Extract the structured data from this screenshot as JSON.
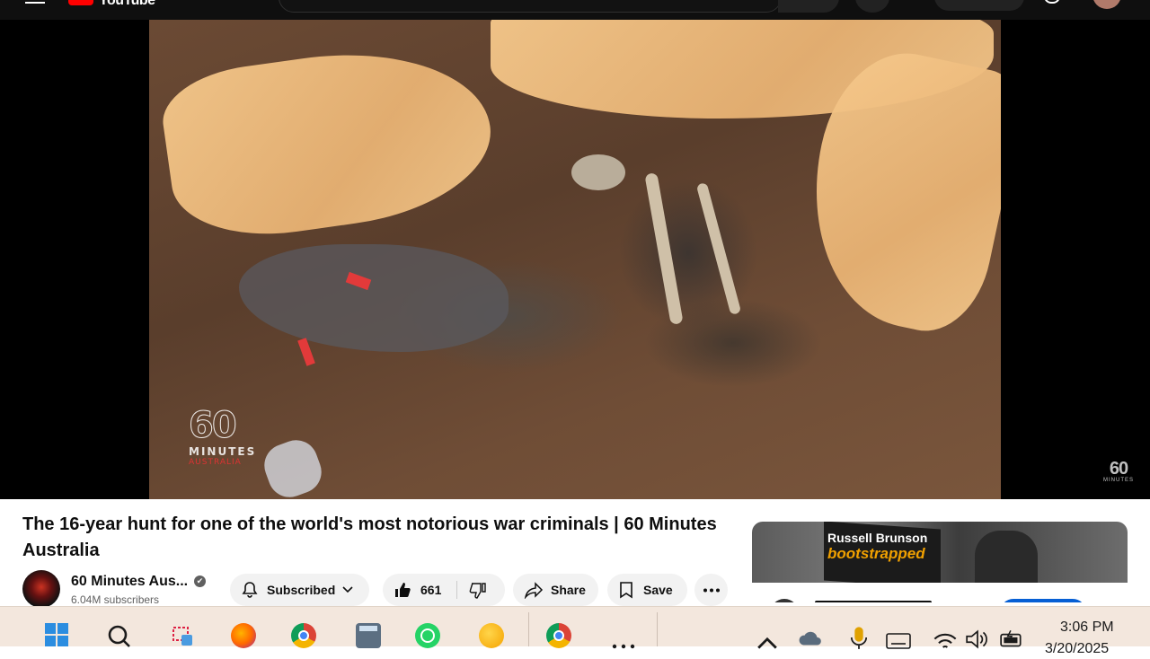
{
  "header": {
    "logo_text": "YouTube"
  },
  "video": {
    "watermark_number": "60",
    "watermark_word": "MINUTES",
    "watermark_country": "AUSTRALIA",
    "corner_number": "60",
    "corner_word": "MINUTES"
  },
  "title": "The 16-year hunt for one of the world's most notorious war criminals | 60 Minutes Australia",
  "channel": {
    "name": "60 Minutes Aus...",
    "subscribers": "6.04M subscribers",
    "verified_icon": "✔"
  },
  "actions": {
    "subscribed_label": "Subscribed",
    "like_count": "661",
    "share_label": "Share",
    "save_label": "Save"
  },
  "recommended": {
    "thumb_line1": "Russell Brunson",
    "thumb_line2": "bootstrapped"
  },
  "taskbar": {
    "time": "3:06 PM",
    "date": "3/20/2025",
    "icons": [
      "windows-start-icon",
      "search-icon",
      "snipping-tool-icon",
      "firefox-icon",
      "chrome-icon",
      "calculator-icon",
      "whatsapp-icon",
      "weather-icon",
      "chrome-canary-icon",
      "more-apps-icon"
    ],
    "tray_icons": [
      "chevron-up-icon",
      "onedrive-icon",
      "microphone-icon",
      "keyboard-icon",
      "wifi-icon",
      "volume-icon",
      "battery-icon"
    ]
  },
  "colors": {
    "youtube_red": "#ff0000",
    "pill_bg": "#f2f2f2",
    "taskbar_bg": "#f3e7dd",
    "accent_blue": "#065fd4"
  }
}
